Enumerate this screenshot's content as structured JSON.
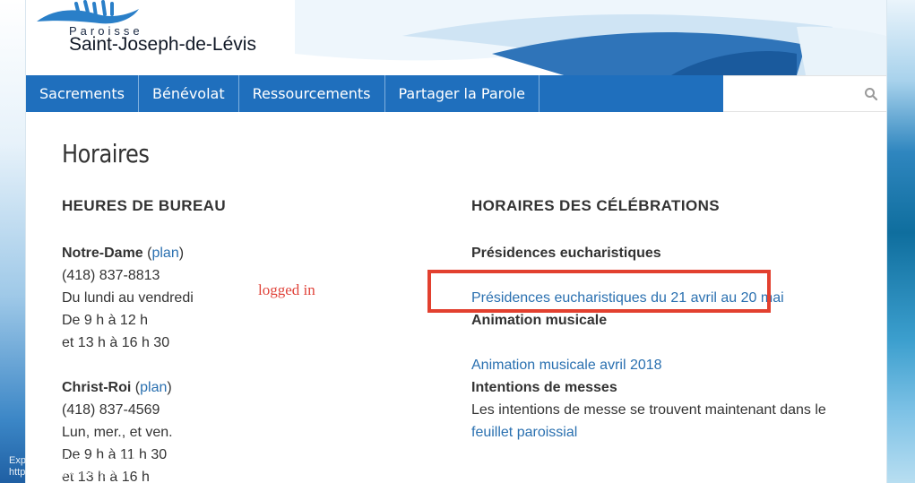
{
  "logo": {
    "small": "Paroisse",
    "big": "Saint-Joseph-de-Lévis"
  },
  "nav": {
    "items": [
      "Sacrements",
      "Bénévolat",
      "Ressourcements",
      "Partager la Parole"
    ]
  },
  "search": {
    "value": "",
    "icon": "search-icon"
  },
  "page_title": "Horaires",
  "office": {
    "title": "HEURES DE BUREAU",
    "notre_dame": {
      "name": "Notre-Dame",
      "plan_open": " (",
      "plan_link": "plan",
      "plan_close": ")",
      "phone": "(418) 837-8813",
      "days": "Du lundi au vendredi",
      "hours1": "De 9 h à 12 h",
      "hours2": "et 13 h à 16 h 30"
    },
    "christ_roi": {
      "name": "Christ-Roi",
      "plan_open": " (",
      "plan_link": "plan",
      "plan_close": ")",
      "phone": "(418) 837-4569",
      "days": "Lun, mer., et ven.",
      "hours1": "De 9 h à 11 h 30",
      "hours2": "et 13 h à 16 h"
    }
  },
  "celebrations": {
    "title": "HORAIRES DES CÉLÉBRATIONS",
    "presidences_heading": "Présidences eucharistiques",
    "presidences_link": "Présidences eucharistiques du 21 avril au 20 mai",
    "animation_heading": "Animation musicale",
    "animation_link": "Animation musicale avril 2018",
    "intentions_heading": "Intentions de messes",
    "intentions_text": "Les intentions de messe se trouvent maintenant dans le",
    "intentions_link": "feuillet paroissial"
  },
  "annotation": {
    "logged_in": "logged in",
    "box_color": "#e2402f"
  },
  "watermark": {
    "line1": "Explain and Send Screenshots",
    "line2": "https://www.paroissesjdl.org"
  },
  "colors": {
    "nav_bg": "#1f6fbd",
    "link": "#2a70b0",
    "text": "#333333"
  }
}
